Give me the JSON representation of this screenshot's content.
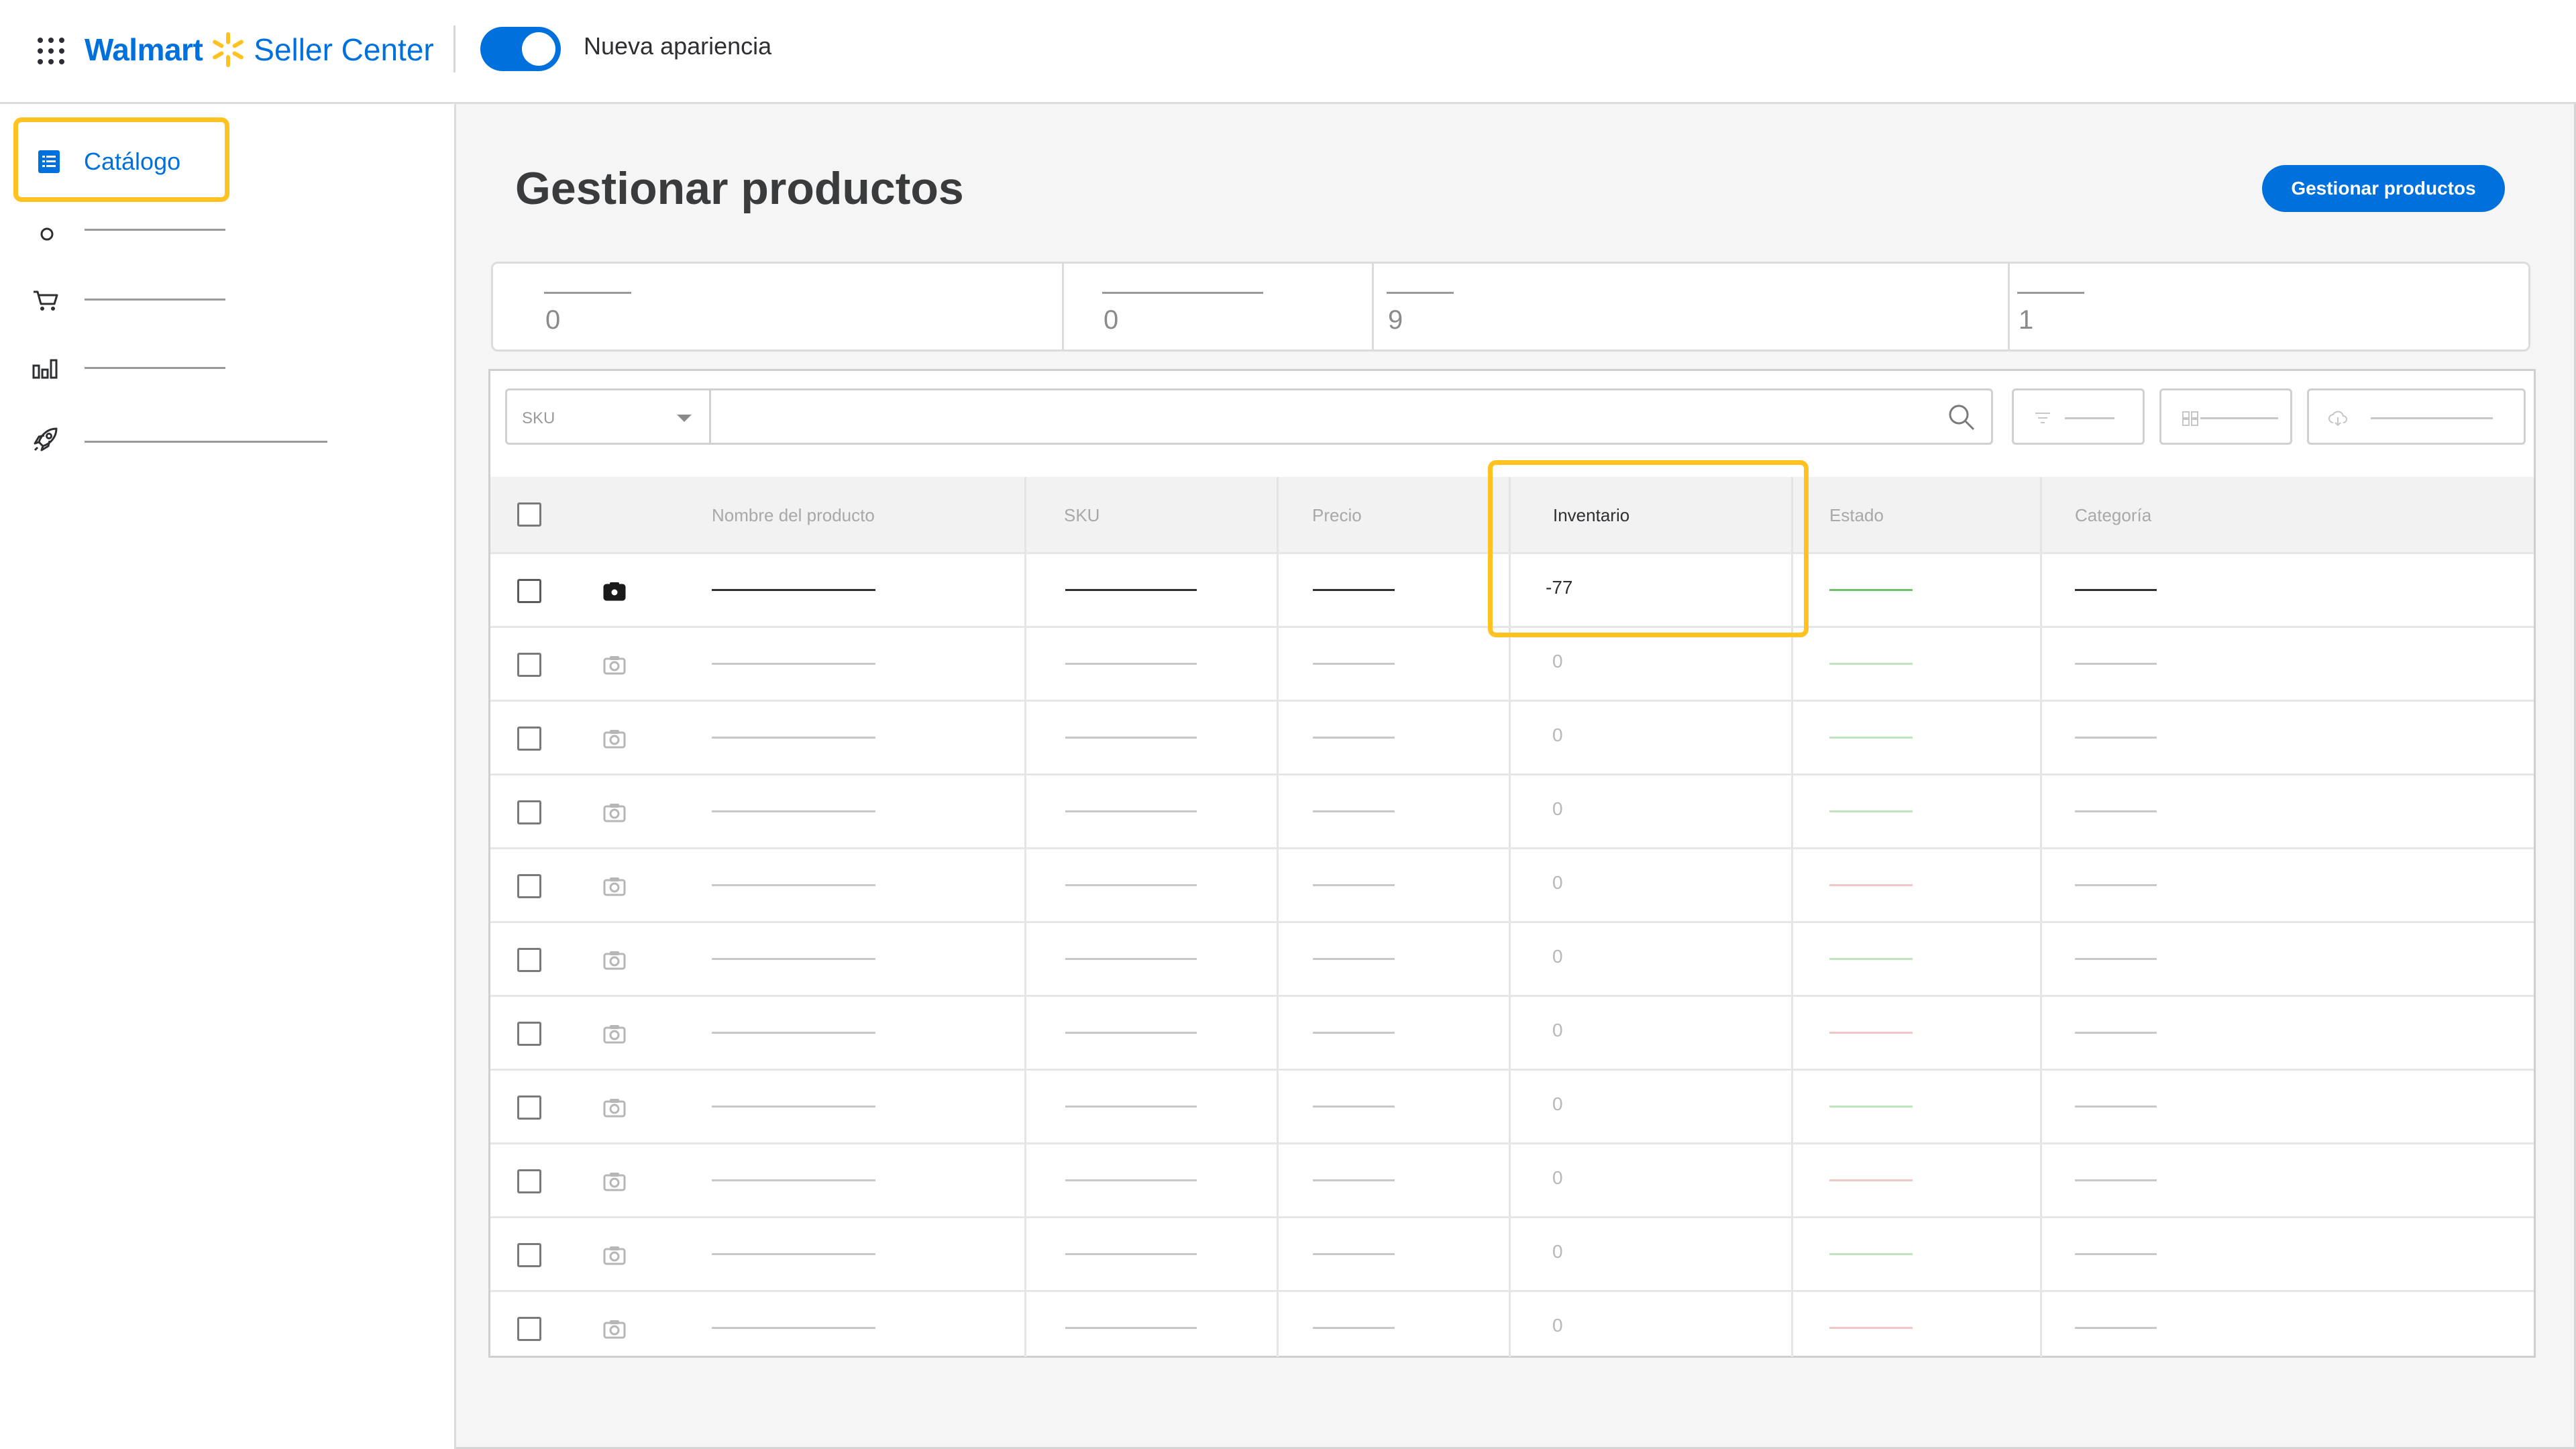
{
  "header": {
    "brand_primary": "Walmart",
    "brand_secondary": "Seller Center",
    "toggle_label": "Nueva apariencia",
    "toggle_on": true,
    "accent_color": "#0071dc",
    "highlight_color": "#ffc220"
  },
  "sidebar": {
    "active_item": {
      "label": "Catálogo",
      "icon": "list-icon"
    },
    "items": [
      {
        "icon": "circle-icon"
      },
      {
        "icon": "cart-icon"
      },
      {
        "icon": "bar-chart-icon"
      },
      {
        "icon": "rocket-icon"
      }
    ]
  },
  "main": {
    "page_title": "Gestionar productos",
    "primary_button": "Gestionar productos",
    "stats": [
      {
        "value": "0"
      },
      {
        "value": "0"
      },
      {
        "value": "9"
      },
      {
        "value": "1"
      }
    ],
    "toolbar": {
      "search_field_selected": "SKU",
      "search_placeholder": "",
      "buttons": [
        {
          "icon": "filter-icon"
        },
        {
          "icon": "columns-icon"
        },
        {
          "icon": "cloud-download-icon"
        }
      ]
    },
    "table": {
      "columns": [
        "Nombre del producto",
        "SKU",
        "Precio",
        "Inventario",
        "Estado",
        "Categoría"
      ],
      "rows": [
        {
          "inventory": "-77",
          "status": "green",
          "active": true
        },
        {
          "inventory": "0",
          "status": "green",
          "active": false
        },
        {
          "inventory": "0",
          "status": "green",
          "active": false
        },
        {
          "inventory": "0",
          "status": "green",
          "active": false
        },
        {
          "inventory": "0",
          "status": "red",
          "active": false
        },
        {
          "inventory": "0",
          "status": "green",
          "active": false
        },
        {
          "inventory": "0",
          "status": "red",
          "active": false
        },
        {
          "inventory": "0",
          "status": "green",
          "active": false
        },
        {
          "inventory": "0",
          "status": "red",
          "active": false
        },
        {
          "inventory": "0",
          "status": "green",
          "active": false
        },
        {
          "inventory": "0",
          "status": "red",
          "active": false
        }
      ]
    }
  }
}
